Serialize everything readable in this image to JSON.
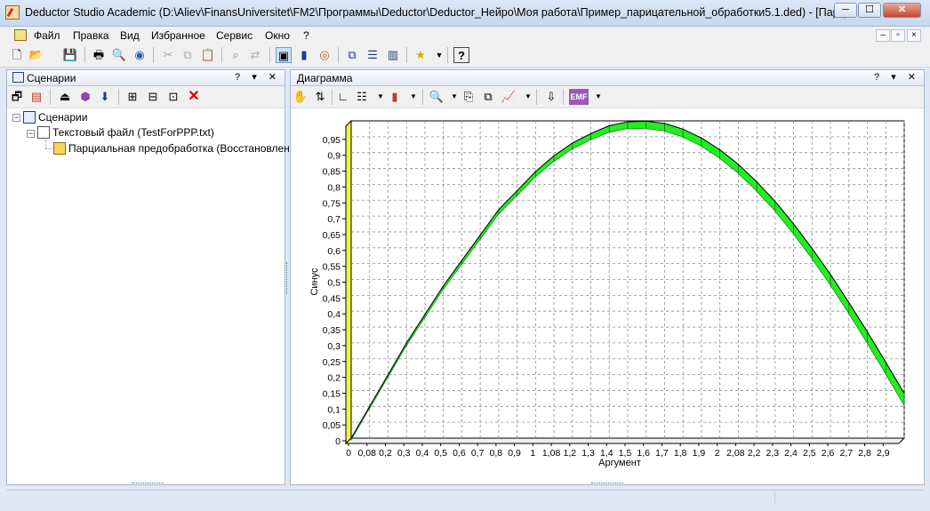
{
  "window": {
    "title": "Deductor Studio Academic (D:\\Aliev\\FinansUniversitet\\FM2\\Программы\\Deductor\\Deductor_Нейро\\Моя работа\\Пример_парицательной_обработки5.1.ded) - [Парц...",
    "buttons": [
      "─",
      "☐",
      "✕"
    ]
  },
  "menu": {
    "items": [
      "Файл",
      "Правка",
      "Вид",
      "Избранное",
      "Сервис",
      "Окно",
      "?"
    ]
  },
  "left_panel": {
    "title": "Сценарии",
    "tools": "? ▾ ✕",
    "tree": [
      {
        "label": "Сценарии",
        "level": 0
      },
      {
        "label": "Текстовый файл (TestForPPP.txt)",
        "level": 1
      },
      {
        "label": "Парциальная предобработка (Восстановление)",
        "level": 2
      }
    ]
  },
  "right_panel": {
    "title": "Диаграмма",
    "tools": "? ▾ ✕"
  },
  "chart_data": {
    "type": "area",
    "ylabel": "Синус",
    "xlabel": "Аргумент",
    "ylim": [
      0,
      1
    ],
    "xlim": [
      0,
      3
    ],
    "y_ticks": [
      "0",
      "0,05",
      "0,1",
      "0,15",
      "0,2",
      "0,25",
      "0,3",
      "0,35",
      "0,4",
      "0,45",
      "0,5",
      "0,55",
      "0,6",
      "0,65",
      "0,7",
      "0,75",
      "0,8",
      "0,85",
      "0,9",
      "0,95"
    ],
    "x_ticks": [
      "0",
      "0,08",
      "0,2",
      "0,3",
      "0,4",
      "0,5",
      "0,6",
      "0,7",
      "0,8",
      "0,9",
      "1",
      "1,08",
      "1,2",
      "1,3",
      "1,4",
      "1,5",
      "1,6",
      "1,7",
      "1,8",
      "1,9",
      "2",
      "2,08",
      "2,2",
      "2,3",
      "2,4",
      "2,5",
      "2,6",
      "2,7",
      "2,8",
      "2,9"
    ],
    "x": [
      0,
      0.1,
      0.2,
      0.3,
      0.4,
      0.5,
      0.6,
      0.7,
      0.8,
      0.9,
      1.0,
      1.1,
      1.2,
      1.3,
      1.4,
      1.5,
      1.6,
      1.7,
      1.8,
      1.9,
      2.0,
      2.1,
      2.2,
      2.3,
      2.4,
      2.5,
      2.6,
      2.7,
      2.8,
      2.9,
      3.0
    ],
    "y": [
      0,
      0.1,
      0.2,
      0.3,
      0.39,
      0.48,
      0.56,
      0.64,
      0.72,
      0.78,
      0.84,
      0.89,
      0.93,
      0.96,
      0.985,
      0.997,
      0.999,
      0.992,
      0.974,
      0.946,
      0.909,
      0.863,
      0.808,
      0.746,
      0.675,
      0.598,
      0.516,
      0.427,
      0.335,
      0.239,
      0.141
    ],
    "colors": {
      "fill": "#22ee22",
      "stroke": "#0b5f0b",
      "wall": "#f5f04a",
      "grid": "#8c8c8c"
    },
    "grid": true
  }
}
